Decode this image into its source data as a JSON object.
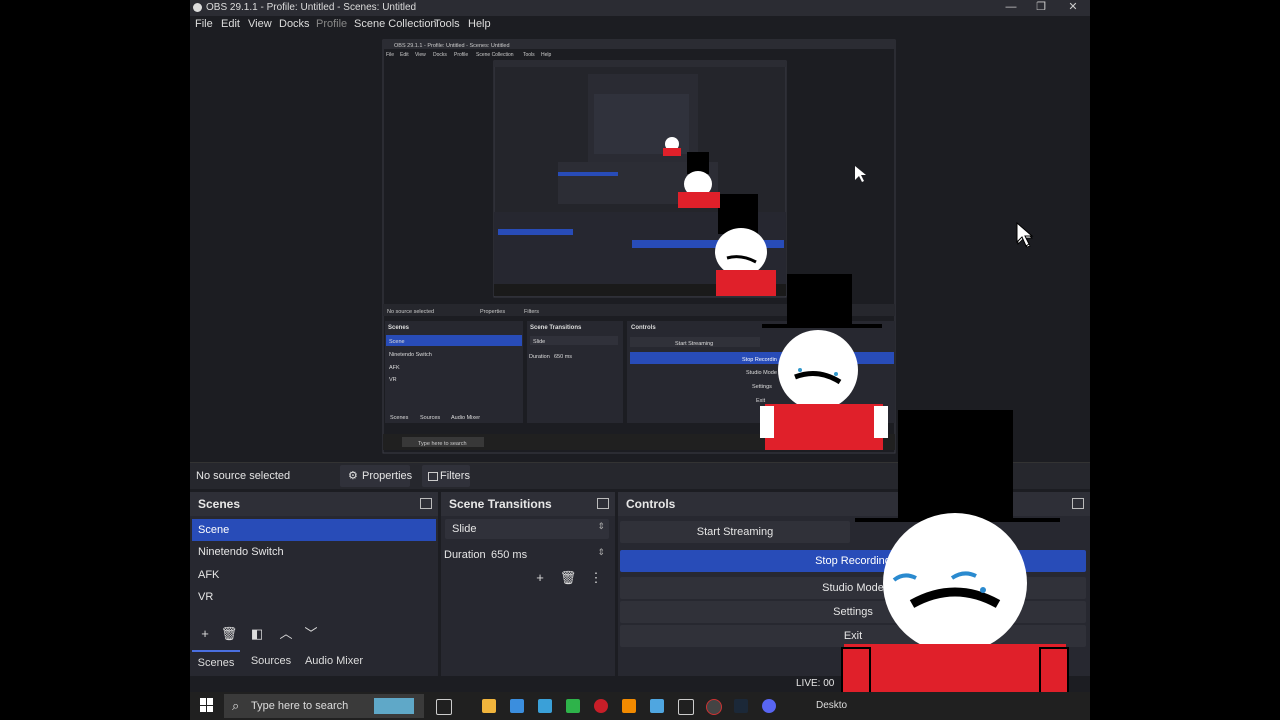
{
  "titlebar": {
    "title": "OBS 29.1.1 - Profile: Untitled - Scenes: Untitled",
    "minimize": "—",
    "restore": "❐",
    "close": "✕"
  },
  "menu": {
    "file": "File",
    "edit": "Edit",
    "view": "View",
    "docks": "Docks",
    "profile": "Profile",
    "scene_collection": "Scene Collection",
    "tools": "Tools",
    "help": "Help"
  },
  "source_bar": {
    "status": "No source selected",
    "properties": "Properties",
    "filters": "Filters"
  },
  "scenes": {
    "header": "Scenes",
    "items": [
      "Scene",
      "Ninetendo Switch",
      "AFK",
      "VR"
    ],
    "selected": "Scene"
  },
  "transitions": {
    "header": "Scene Transitions",
    "type": "Slide",
    "duration_label": "Duration",
    "duration_value": "650 ms"
  },
  "controls": {
    "header": "Controls",
    "start_streaming": "Start Streaming",
    "stop_recording": "Stop Recording",
    "studio_mode": "Studio Mode",
    "settings": "Settings",
    "exit": "Exit",
    "live_status": "LIVE: 00"
  },
  "bottom_tabs": {
    "scenes": "Scenes",
    "sources": "Sources",
    "audio_mixer": "Audio Mixer"
  },
  "taskbar": {
    "search_placeholder": "Type here to search",
    "desktop": "Deskto"
  },
  "nested_preview": {
    "title": "OBS 29.1.1 - Profile: Untitled - Scenes: Untitled",
    "menu": [
      "File",
      "Edit",
      "View",
      "Docks",
      "Profile",
      "Scene Collection",
      "Tools",
      "Help"
    ],
    "status": "No source selected",
    "properties": "Properties",
    "filters": "Filters",
    "scenes_header": "Scenes",
    "scenes": [
      "Scene",
      "Ninetendo Switch",
      "AFK",
      "VR"
    ],
    "transitions_header": "Scene Transitions",
    "transition": "Slide",
    "duration_label": "Duration",
    "duration_value": "650 ms",
    "controls_header": "Controls",
    "start_streaming": "Start Streaming",
    "stop_recording": "Stop Recordin",
    "studio_mode": "Studio Mode",
    "settings": "Settings",
    "exit": "Exit",
    "tabs": [
      "Scenes",
      "Sources",
      "Audio Mixer"
    ],
    "search": "Type here to search"
  },
  "colors": {
    "selected": "#284cb8",
    "accent_red": "#e0202a",
    "bg": "#1c1d22"
  }
}
